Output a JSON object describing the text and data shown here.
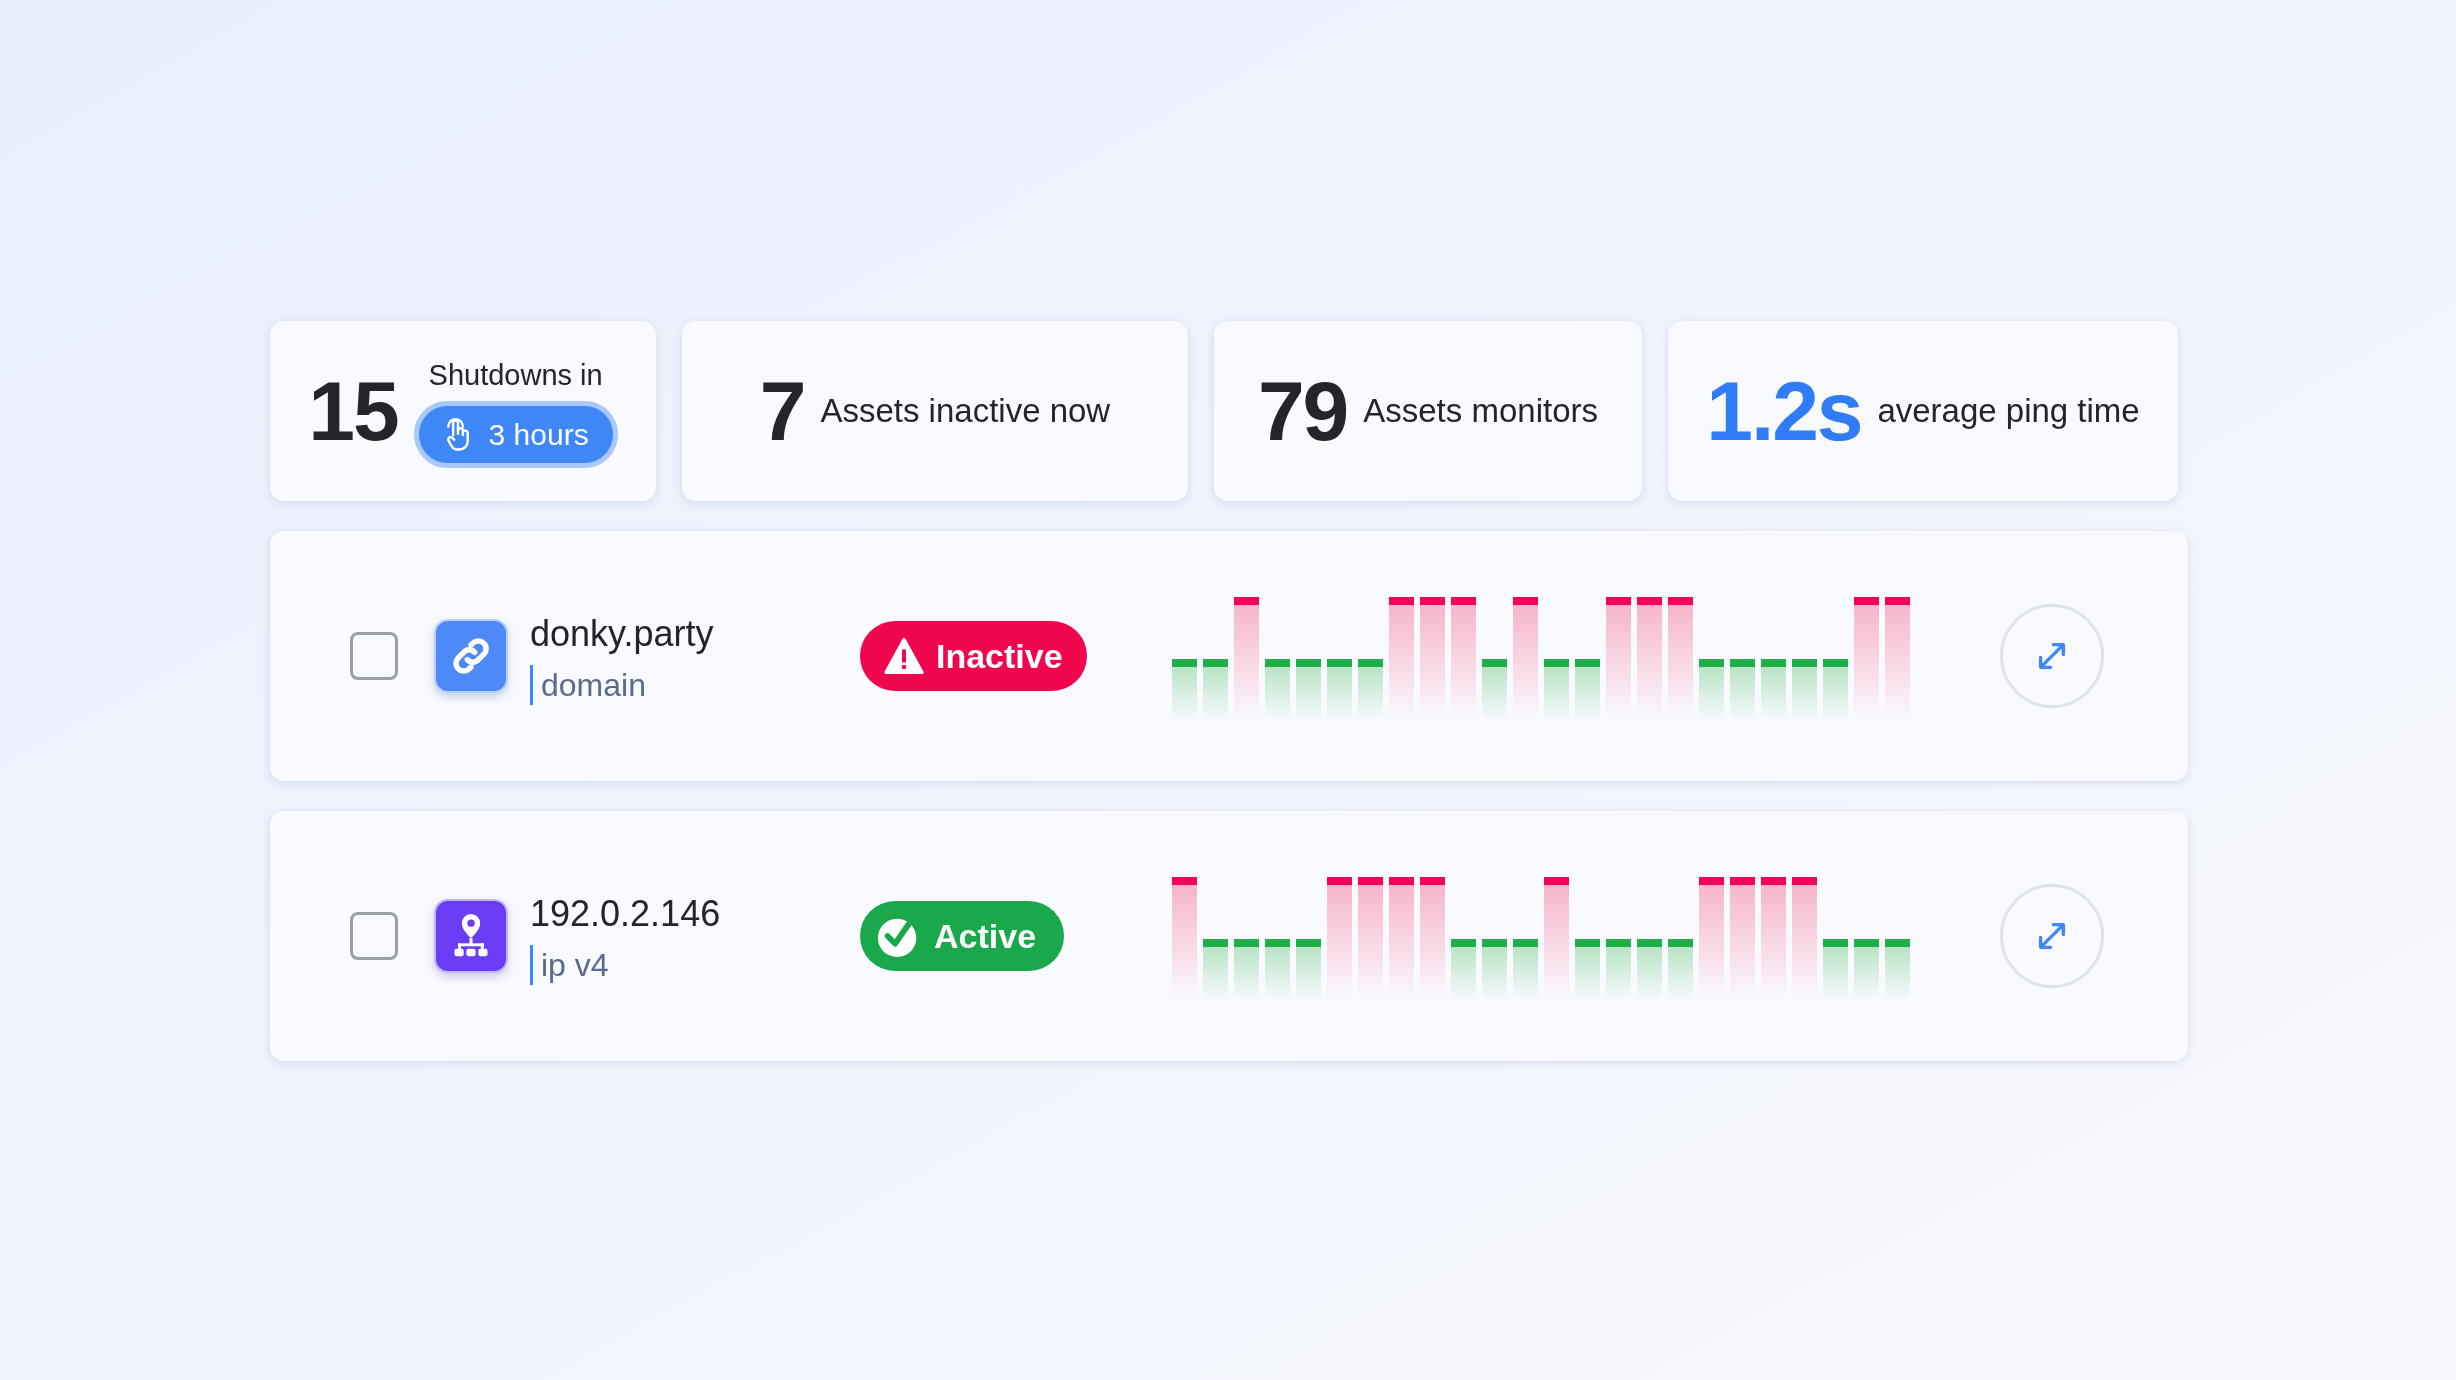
{
  "stats": [
    {
      "value": "15",
      "label": "Shutdowns in",
      "badge": "3 hours",
      "accent": false
    },
    {
      "value": "7",
      "label": "Assets inactive now",
      "accent": false
    },
    {
      "value": "79",
      "label": "Assets monitors",
      "accent": false
    },
    {
      "value": "1.2s",
      "label": "average ping time",
      "accent": true
    }
  ],
  "assets": [
    {
      "kind": "domain",
      "name": "donky.party",
      "type": "domain",
      "checked": false,
      "status": {
        "kind": "inactive",
        "label": "Inactive"
      },
      "bars": [
        {
          "down": false
        },
        {
          "down": false
        },
        {
          "down": true
        },
        {
          "down": false
        },
        {
          "down": false
        },
        {
          "down": false
        },
        {
          "down": false
        },
        {
          "down": true
        },
        {
          "down": true
        },
        {
          "down": true
        },
        {
          "down": false
        },
        {
          "down": true
        },
        {
          "down": false
        },
        {
          "down": false
        },
        {
          "down": true
        },
        {
          "down": true
        },
        {
          "down": true
        },
        {
          "down": false
        },
        {
          "down": false
        },
        {
          "down": false
        },
        {
          "down": false
        },
        {
          "down": false
        },
        {
          "down": true
        },
        {
          "down": true
        }
      ]
    },
    {
      "kind": "ip",
      "name": "192.0.2.146",
      "type": "ip v4",
      "checked": false,
      "status": {
        "kind": "active",
        "label": "Active"
      },
      "bars": [
        {
          "down": true
        },
        {
          "down": false
        },
        {
          "down": false
        },
        {
          "down": false
        },
        {
          "down": false
        },
        {
          "down": true
        },
        {
          "down": true
        },
        {
          "down": true
        },
        {
          "down": true
        },
        {
          "down": false
        },
        {
          "down": false
        },
        {
          "down": false
        },
        {
          "down": true
        },
        {
          "down": false
        },
        {
          "down": false
        },
        {
          "down": false
        },
        {
          "down": false
        },
        {
          "down": true
        },
        {
          "down": true
        },
        {
          "down": true
        },
        {
          "down": true
        },
        {
          "down": false
        },
        {
          "down": false
        },
        {
          "down": false
        }
      ]
    }
  ]
}
